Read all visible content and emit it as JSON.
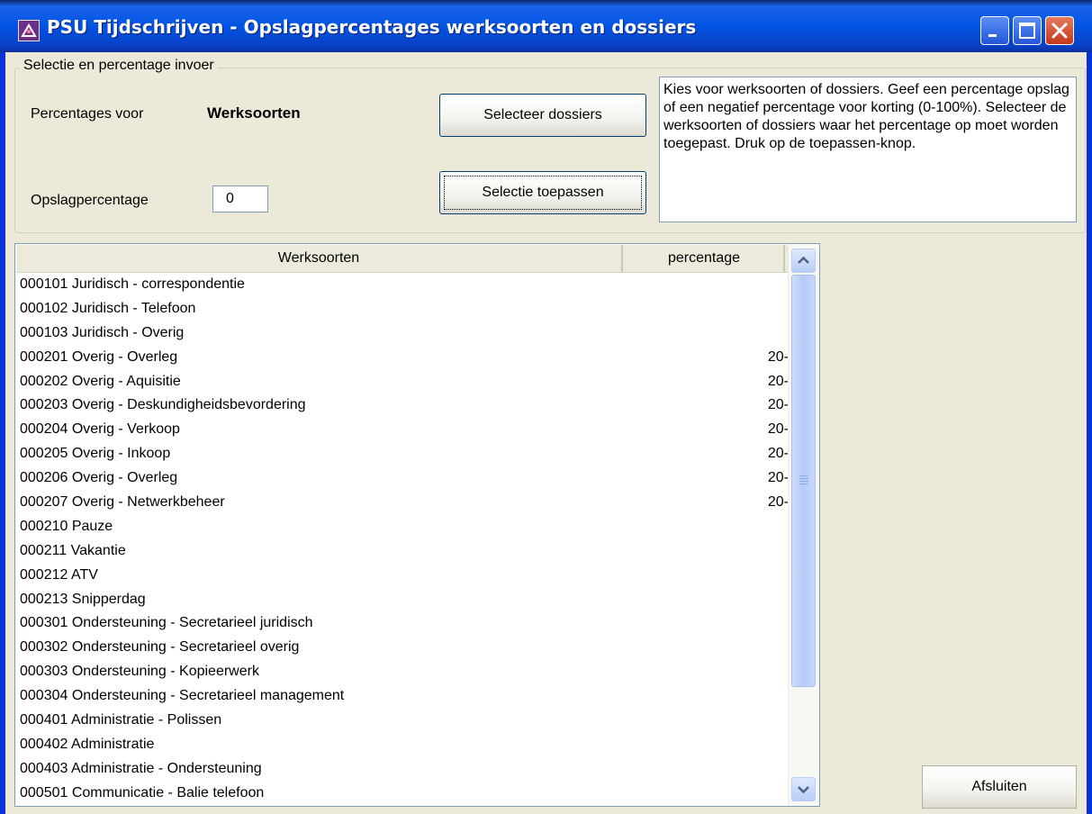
{
  "window": {
    "title": "PSU Tijdschrijven - Opslagpercentages werksoorten en dossiers",
    "app_icon": "app-icon",
    "controls": [
      "minimize-icon",
      "maximize-icon",
      "close-icon"
    ]
  },
  "selection": {
    "group_label": "Selectie en percentage invoer",
    "percentages_for_label": "Percentages voor",
    "percentages_for_value": "Werksoorten",
    "surcharge_label": "Opslagpercentage",
    "surcharge_value": "0",
    "select_dossiers_button": "Selecteer dossiers",
    "apply_selection_button": "Selectie toepassen",
    "info_text": "Kies voor werksoorten of dossiers. Geef een percentage opslag of een negatief percentage voor korting (0-100%). Selecteer de werksoorten of dossiers waar het percentage op moet worden toegepast. Druk op de toepassen-knop."
  },
  "list": {
    "columns": [
      "Werksoorten",
      "percentage"
    ],
    "rows": [
      [
        "000101 Juridisch - correspondentie",
        ""
      ],
      [
        "000102 Juridisch - Telefoon",
        ""
      ],
      [
        "000103 Juridisch - Overig",
        ""
      ],
      [
        "000201 Overig - Overleg",
        "20-"
      ],
      [
        "000202 Overig - Aquisitie",
        "20-"
      ],
      [
        "000203 Overig - Deskundigheidsbevordering",
        "20-"
      ],
      [
        "000204 Overig - Verkoop",
        "20-"
      ],
      [
        "000205 Overig - Inkoop",
        "20-"
      ],
      [
        "000206 Overig - Overleg",
        "20-"
      ],
      [
        "000207 Overig - Netwerkbeheer",
        "20-"
      ],
      [
        "000210 Pauze",
        ""
      ],
      [
        "000211 Vakantie",
        ""
      ],
      [
        "000212 ATV",
        ""
      ],
      [
        "000213 Snipperdag",
        ""
      ],
      [
        "000301 Ondersteuning - Secretarieel juridisch",
        ""
      ],
      [
        "000302 Ondersteuning - Secretarieel overig",
        ""
      ],
      [
        "000303 Ondersteuning - Kopieerwerk",
        ""
      ],
      [
        "000304 Ondersteuning - Secretarieel management",
        ""
      ],
      [
        "000401 Administratie - Polissen",
        ""
      ],
      [
        "000402 Administratie",
        ""
      ],
      [
        "000403 Administratie - Ondersteuning",
        ""
      ],
      [
        "000501 Communicatie - Balie telefoon",
        ""
      ]
    ]
  },
  "footer": {
    "close_button": "Afsluiten"
  },
  "colors": {
    "titlebar": "#0054e3",
    "dialog_bg": "#ece9d8",
    "close_btn": "#c4381c"
  }
}
